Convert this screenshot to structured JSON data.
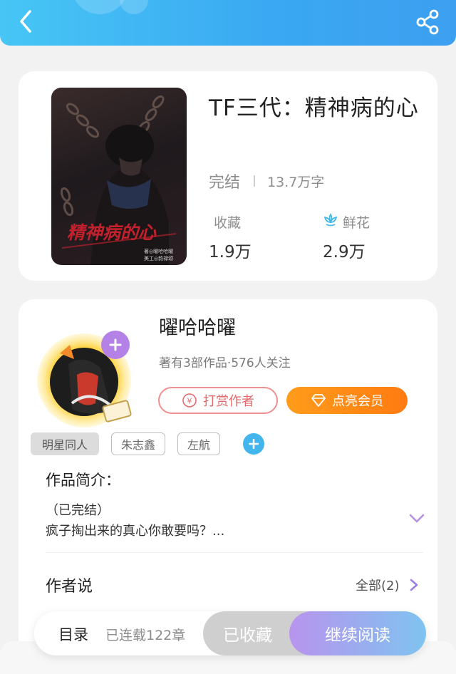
{
  "header": {
    "back_icon": "chevron-left-icon",
    "share_icon": "share-icon",
    "color_start": "#47c6f5",
    "color_end": "#3d9ff0"
  },
  "book": {
    "title": "TF三代：精神病的心",
    "status": "完结",
    "word_count": "13.7万字",
    "favorites_label": "收藏",
    "favorites_value": "1.9万",
    "flowers_label": "鲜花",
    "flowers_value": "2.9万",
    "cover_title": "精神病的心",
    "cover_credit_1": "著◎曜哈哈曜",
    "cover_credit_2": "美工◎韵禄颂"
  },
  "author": {
    "name": "曜哈哈曜",
    "meta": "著有3部作品·576人关注",
    "tip_label": "打赏作者",
    "vip_label": "点亮会员",
    "follow_icon": "plus-icon"
  },
  "tags": [
    {
      "label": "明星同人"
    },
    {
      "label": "朱志鑫"
    },
    {
      "label": "左航"
    }
  ],
  "intro": {
    "title": "作品简介：",
    "status": "（已完结）",
    "text": "疯子掏出来的真心你敢要吗？..."
  },
  "author_says": {
    "title": "作者说",
    "all_label": "全部(2)"
  },
  "bottom_bar": {
    "toc_label": "目录",
    "chapters_label": "已连载122章",
    "favorited_label": "已收藏",
    "continue_label": "继续阅读"
  },
  "colors": {
    "accent_blue": "#42b6ec",
    "vip_orange": "#ff7b12",
    "tip_red": "#e36b6b",
    "read_purple": "#b894ee"
  }
}
